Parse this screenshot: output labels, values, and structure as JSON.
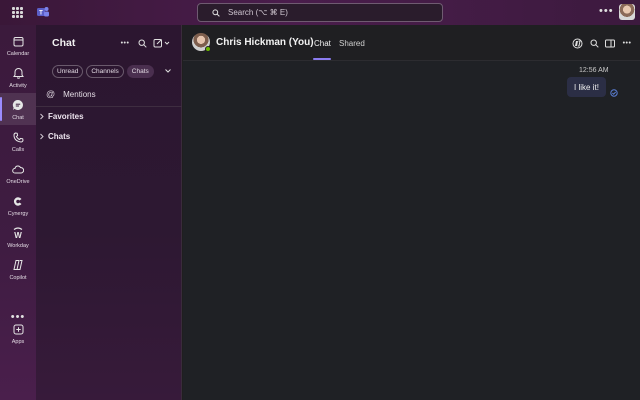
{
  "titlebar": {
    "search_placeholder": "Search (⌥ ⌘ E)",
    "more_label": "•••"
  },
  "rail": {
    "items": [
      {
        "label": "Calendar",
        "icon": "calendar-icon"
      },
      {
        "label": "Activity",
        "icon": "bell-icon"
      },
      {
        "label": "Chat",
        "icon": "chat-icon",
        "active": true
      },
      {
        "label": "Calls",
        "icon": "phone-icon"
      },
      {
        "label": "OneDrive",
        "icon": "cloud-icon"
      },
      {
        "label": "Cynergy",
        "icon": "cynergy-icon"
      },
      {
        "label": "Workday",
        "icon": "workday-icon"
      },
      {
        "label": "Copilot",
        "icon": "copilot-icon"
      },
      {
        "label": "Apps",
        "icon": "apps-icon"
      }
    ],
    "more_label": "•••"
  },
  "chatlist": {
    "title": "Chat",
    "filters": [
      "Unread",
      "Channels",
      "Chats"
    ],
    "active_filter": "Chats",
    "mentions_icon": "@",
    "mentions_label": "Mentions",
    "groups": [
      "Favorites",
      "Chats"
    ],
    "more_label": "•••"
  },
  "conversation": {
    "name": "Chris Hickman (You)",
    "tabs": [
      "Chat",
      "Shared"
    ],
    "active_tab": "Chat",
    "more_label": "•••",
    "messages": [
      {
        "time": "12:56 AM",
        "text": "I like it!",
        "status": "read-receipt-icon"
      }
    ]
  },
  "colors": {
    "accent": "#8b7cf0",
    "rail_bg": "#3b1a3c",
    "presence": "#6bb700",
    "bubble": "#2b2e45"
  }
}
